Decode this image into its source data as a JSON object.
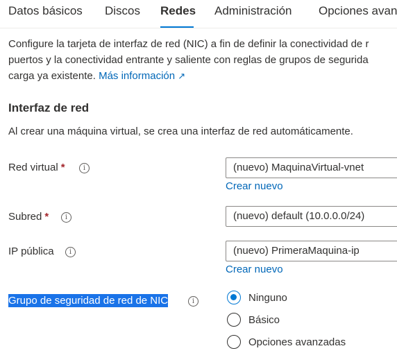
{
  "tabs": [
    {
      "label": "Datos básicos"
    },
    {
      "label": "Discos"
    },
    {
      "label": "Redes",
      "active": true
    },
    {
      "label": "Administración"
    },
    {
      "label": "Opciones avan"
    }
  ],
  "description": {
    "line1": "Configure la tarjeta de interfaz de red (NIC) a fin de definir la conectividad de r",
    "line2": "puertos y la conectividad entrante y saliente con reglas de grupos de segurida",
    "line3": "carga ya existente.",
    "learn_more": "Más información",
    "external_glyph": "↗"
  },
  "network_interface": {
    "title": "Interfaz de red",
    "note": "Al crear una máquina virtual, se crea una interfaz de red automáticamente."
  },
  "fields": {
    "vnet": {
      "label": "Red virtual",
      "required": "*",
      "value": "(nuevo) MaquinaVirtual-vnet",
      "create_new": "Crear nuevo"
    },
    "subnet": {
      "label": "Subred",
      "required": "*",
      "value": "(nuevo) default (10.0.0.0/24)"
    },
    "public_ip": {
      "label": "IP pública",
      "value": "(nuevo) PrimeraMaquina-ip",
      "create_new": "Crear nuevo"
    },
    "nsg": {
      "label": "Grupo de seguridad de red de NIC"
    }
  },
  "info_glyph": "i",
  "nsg_options": [
    {
      "label": "Ninguno",
      "selected": true
    },
    {
      "label": "Básico",
      "selected": false
    },
    {
      "label": "Opciones avanzadas",
      "selected": false
    }
  ],
  "colors": {
    "accent": "#0078d4",
    "link": "#0067b8",
    "required": "#a4262c",
    "selection": "#1a73e8"
  }
}
